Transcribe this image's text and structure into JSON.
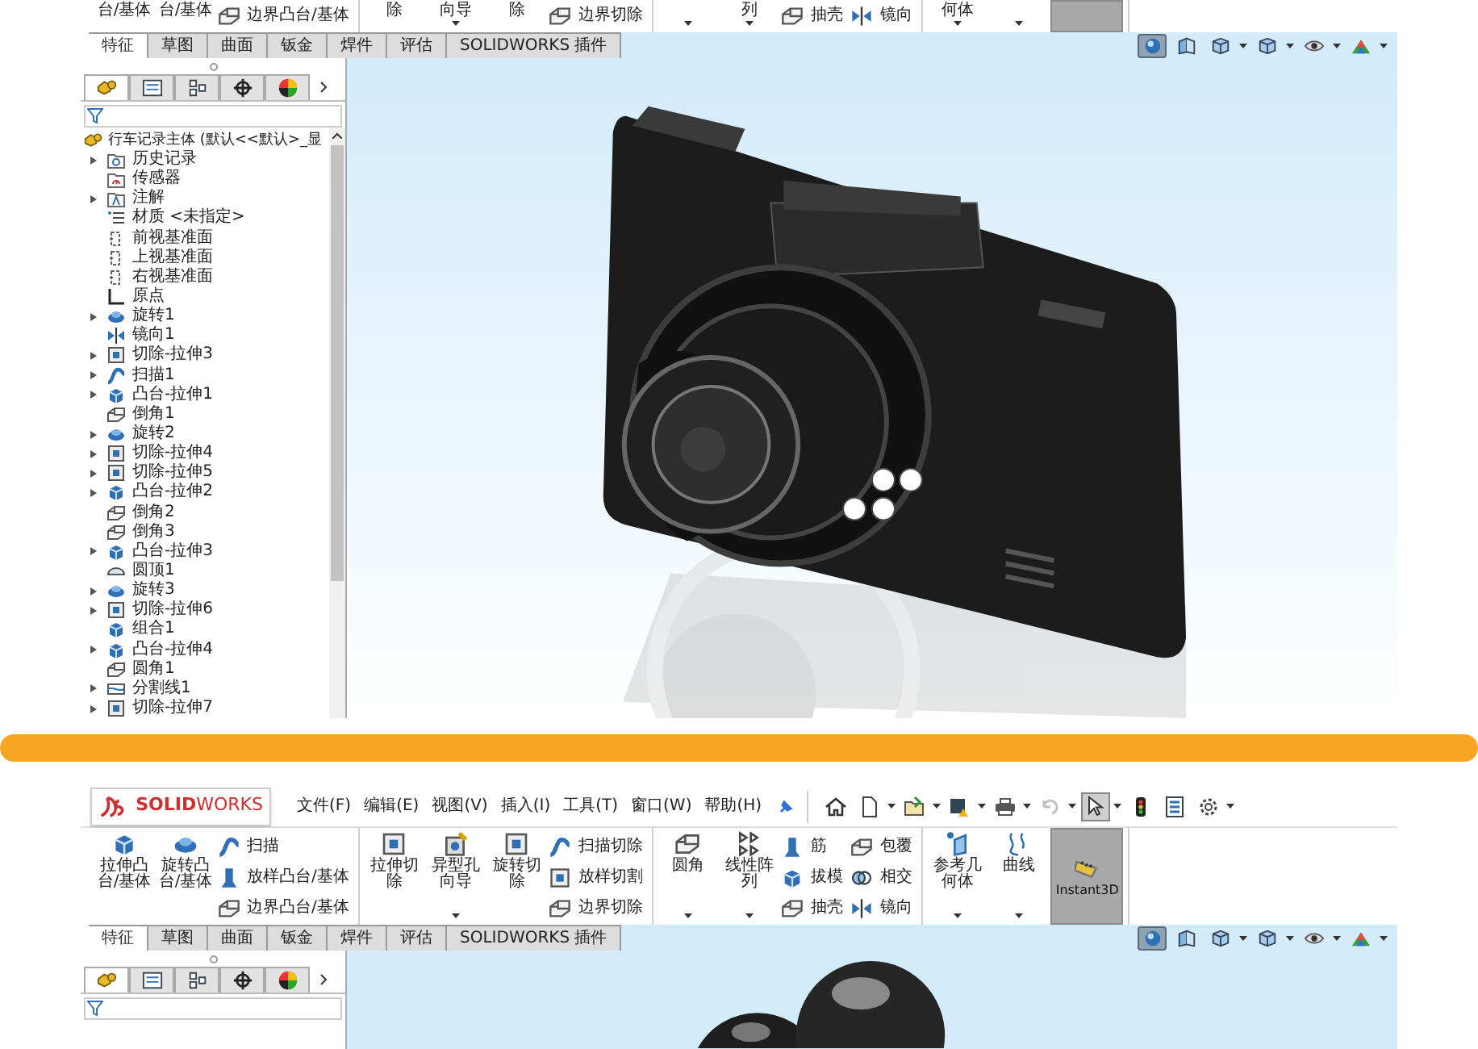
{
  "top_screen": {
    "ribbon": [
      [
        {
          "kind": "large",
          "label": "台/基体"
        },
        {
          "kind": "large",
          "label": "台/基体"
        },
        {
          "kind": "stack",
          "items": [
            {
              "kind": "boundary",
              "label": "边界凸台/基体"
            }
          ]
        }
      ],
      [
        {
          "kind": "large",
          "label": "除"
        },
        {
          "kind": "large",
          "label": "向导",
          "caret": true
        },
        {
          "kind": "large",
          "label": "除"
        },
        {
          "kind": "stack",
          "items": [
            {
              "kind": "boundary-cut",
              "label": "边界切除"
            }
          ]
        }
      ],
      [
        {
          "kind": "large",
          "caret": true
        },
        {
          "kind": "large",
          "label": "列",
          "caret": true
        },
        {
          "kind": "stack",
          "items": [
            {
              "kind": "shell",
              "label": "抽壳"
            }
          ]
        },
        {
          "kind": "stack",
          "items": [
            {
              "kind": "mirror",
              "label": "镜向"
            }
          ]
        }
      ],
      [
        {
          "kind": "large",
          "label": "何体",
          "caret": true
        },
        {
          "kind": "large",
          "caret": true
        },
        {
          "kind": "tool",
          "selected": true
        }
      ]
    ],
    "tabs": [
      {
        "label": "特征",
        "selected": true
      },
      {
        "label": "草图",
        "selected": false
      },
      {
        "label": "曲面",
        "selected": false
      },
      {
        "label": "钣金",
        "selected": false
      },
      {
        "label": "焊件",
        "selected": false
      },
      {
        "label": "评估",
        "selected": false
      },
      {
        "label": "SOLIDWORKS 插件",
        "selected": false
      }
    ],
    "view_toolbar": [
      {
        "kind": "view-sphere",
        "selected": true
      },
      {
        "kind": "section-view",
        "selected": false
      },
      {
        "kind": "box-view",
        "selected": false,
        "caret": true
      },
      {
        "kind": "display-cube",
        "selected": false,
        "caret": true
      },
      {
        "kind": "eye",
        "selected": false,
        "caret": true
      },
      {
        "kind": "scene",
        "selected": false,
        "caret": true
      }
    ],
    "panel_tabs": [
      {
        "kind": "part",
        "selected": true
      },
      {
        "kind": "property-list",
        "selected": false
      },
      {
        "kind": "configuration",
        "selected": false
      },
      {
        "kind": "crosshair",
        "selected": false
      },
      {
        "kind": "appearance",
        "selected": false
      }
    ],
    "tree": {
      "root": "行车记录主体 (默认<<默认>_显",
      "items": [
        {
          "label": "历史记录",
          "kind": "folder",
          "expandable": true
        },
        {
          "label": "传感器",
          "kind": "sensor-folder",
          "expandable": false
        },
        {
          "label": "注解",
          "kind": "annotation-folder",
          "expandable": true
        },
        {
          "label": "材质 <未指定>",
          "kind": "material-list",
          "expandable": false
        },
        {
          "label": "前视基准面",
          "kind": "plane",
          "expandable": false
        },
        {
          "label": "上视基准面",
          "kind": "plane",
          "expandable": false
        },
        {
          "label": "右视基准面",
          "kind": "plane",
          "expandable": false
        },
        {
          "label": "原点",
          "kind": "origin-axes",
          "expandable": false
        },
        {
          "label": "旋转1",
          "kind": "revolve",
          "expandable": true
        },
        {
          "label": "镜向1",
          "kind": "mirror",
          "expandable": false
        },
        {
          "label": "切除-拉伸3",
          "kind": "cut-extrude",
          "expandable": true
        },
        {
          "label": "扫描1",
          "kind": "sweep",
          "expandable": true
        },
        {
          "label": "凸台-拉伸1",
          "kind": "extrude",
          "expandable": true
        },
        {
          "label": "倒角1",
          "kind": "chamfer",
          "expandable": false
        },
        {
          "label": "旋转2",
          "kind": "revolve",
          "expandable": true
        },
        {
          "label": "切除-拉伸4",
          "kind": "cut-extrude",
          "expandable": true
        },
        {
          "label": "切除-拉伸5",
          "kind": "cut-extrude",
          "expandable": true
        },
        {
          "label": "凸台-拉伸2",
          "kind": "extrude",
          "expandable": true
        },
        {
          "label": "倒角2",
          "kind": "chamfer",
          "expandable": false
        },
        {
          "label": "倒角3",
          "kind": "chamfer",
          "expandable": false
        },
        {
          "label": "凸台-拉伸3",
          "kind": "extrude",
          "expandable": true
        },
        {
          "label": "圆顶1",
          "kind": "dome",
          "expandable": false
        },
        {
          "label": "旋转3",
          "kind": "revolve",
          "expandable": true
        },
        {
          "label": "切除-拉伸6",
          "kind": "cut-extrude",
          "expandable": true
        },
        {
          "label": "组合1",
          "kind": "combine",
          "expandable": false
        },
        {
          "label": "凸台-拉伸4",
          "kind": "extrude",
          "expandable": true
        },
        {
          "label": "圆角1",
          "kind": "fillet",
          "expandable": false
        },
        {
          "label": "分割线1",
          "kind": "split-line",
          "expandable": true
        },
        {
          "label": "切除-拉伸7",
          "kind": "cut-extrude",
          "expandable": true
        }
      ]
    }
  },
  "bottom_screen": {
    "menu_bar": {
      "logo": "**SOLID**WORKS",
      "menus": [
        "文件(F)",
        "编辑(E)",
        "视图(V)",
        "插入(I)",
        "工具(T)",
        "窗口(W)",
        "帮助(H)"
      ],
      "toolbar": [
        {
          "kind": "home",
          "caret": false,
          "disabled": false,
          "selected": false
        },
        {
          "kind": "new-document",
          "caret": true,
          "disabled": false,
          "selected": false
        },
        {
          "kind": "open-folder",
          "caret": true,
          "disabled": false,
          "selected": false
        },
        {
          "kind": "save",
          "caret": true,
          "disabled": false,
          "selected": false
        },
        {
          "kind": "printer",
          "caret": true,
          "disabled": false,
          "selected": false
        },
        {
          "kind": "undo",
          "caret": true,
          "disabled": true,
          "selected": false
        },
        {
          "kind": "pointer",
          "caret": true,
          "disabled": false,
          "selected": true
        },
        {
          "kind": "traffic-light",
          "caret": false,
          "disabled": false,
          "selected": false
        },
        {
          "kind": "list-options",
          "caret": false,
          "disabled": false,
          "selected": false
        },
        {
          "kind": "settings",
          "caret": true,
          "disabled": false,
          "selected": false
        }
      ]
    },
    "ribbon": [
      [
        {
          "kind": "large",
          "label": "拉伸凸台/基体"
        },
        {
          "kind": "large",
          "label": "旋转凸台/基体"
        },
        {
          "kind": "stack",
          "items": [
            {
              "kind": "sweep",
              "label": "扫描"
            },
            {
              "kind": "loft",
              "label": "放样凸台/基体"
            },
            {
              "kind": "boundary",
              "label": "边界凸台/基体"
            }
          ]
        }
      ],
      [
        {
          "kind": "large",
          "label": "拉伸切除"
        },
        {
          "kind": "large",
          "label": "异型孔向导",
          "caret": true
        },
        {
          "kind": "large",
          "label": "旋转切除"
        },
        {
          "kind": "stack",
          "items": [
            {
              "kind": "sweep-cut",
              "label": "扫描切除"
            },
            {
              "kind": "loft-cut",
              "label": "放样切割"
            },
            {
              "kind": "boundary-cut",
              "label": "边界切除"
            }
          ]
        }
      ],
      [
        {
          "kind": "large",
          "label": "圆角",
          "caret": true
        },
        {
          "kind": "large",
          "label": "线性阵列",
          "caret": true
        },
        {
          "kind": "stack",
          "items": [
            {
              "kind": "rib",
              "label": "筋"
            },
            {
              "kind": "draft",
              "label": "拔模"
            },
            {
              "kind": "shell",
              "label": "抽壳"
            }
          ]
        },
        {
          "kind": "stack",
          "items": [
            {
              "kind": "wrap",
              "label": "包覆"
            },
            {
              "kind": "intersect",
              "label": "相交"
            },
            {
              "kind": "mirror",
              "label": "镜向"
            }
          ]
        }
      ],
      [
        {
          "kind": "large",
          "label": "参考几何体",
          "caret": true
        },
        {
          "kind": "large",
          "label": "曲线",
          "caret": true
        },
        {
          "kind": "tool",
          "label": "Instant3D",
          "selected": true
        }
      ]
    ],
    "tabs": [
      {
        "label": "特征",
        "selected": true
      },
      {
        "label": "草图",
        "selected": false
      },
      {
        "label": "曲面",
        "selected": false
      },
      {
        "label": "钣金",
        "selected": false
      },
      {
        "label": "焊件",
        "selected": false
      },
      {
        "label": "评估",
        "selected": false
      },
      {
        "label": "SOLIDWORKS 插件",
        "selected": false
      }
    ],
    "view_toolbar": [
      {
        "kind": "view-sphere",
        "selected": true
      },
      {
        "kind": "section-view",
        "selected": false
      },
      {
        "kind": "box-view",
        "selected": false,
        "caret": true
      },
      {
        "kind": "display-cube",
        "selected": false,
        "caret": true
      },
      {
        "kind": "eye",
        "selected": false,
        "caret": true
      },
      {
        "kind": "scene",
        "selected": false,
        "caret": true
      }
    ],
    "panel_tabs": [
      {
        "kind": "part",
        "selected": true
      },
      {
        "kind": "property-list",
        "selected": false
      },
      {
        "kind": "configuration",
        "selected": false
      },
      {
        "kind": "crosshair",
        "selected": false
      },
      {
        "kind": "appearance",
        "selected": false
      }
    ]
  }
}
